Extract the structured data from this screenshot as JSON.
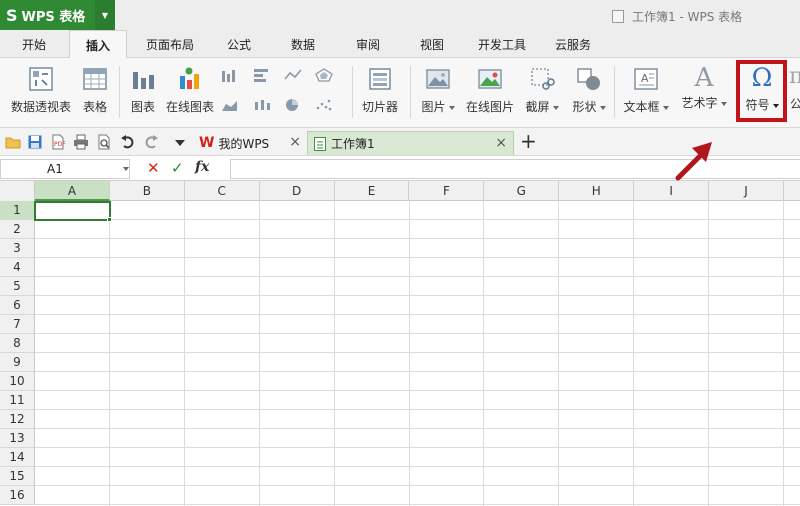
{
  "app": {
    "button_label": "WPS 表格",
    "logo_glyph": "S",
    "window_title": "工作簿1 - WPS 表格"
  },
  "menu": {
    "tabs": [
      {
        "label": "开始",
        "active": false
      },
      {
        "label": "插入",
        "active": true
      },
      {
        "label": "页面布局",
        "active": false
      },
      {
        "label": "公式",
        "active": false
      },
      {
        "label": "数据",
        "active": false
      },
      {
        "label": "审阅",
        "active": false
      },
      {
        "label": "视图",
        "active": false
      },
      {
        "label": "开发工具",
        "active": false
      },
      {
        "label": "云服务",
        "active": false
      }
    ]
  },
  "ribbon": {
    "pivot_table": "数据透视表",
    "table": "表格",
    "chart": "图表",
    "online_chart": "在线图表",
    "slicer": "切片器",
    "picture": "图片",
    "online_picture": "在线图片",
    "screenshot": "截屏",
    "shapes": "形状",
    "textbox": "文本框",
    "wordart": "艺术字",
    "symbol": "符号",
    "symbol_glyph": "Ω",
    "wordart_glyph": "A",
    "formula_cut": "公"
  },
  "doc_tabs": {
    "tabs": [
      {
        "label": "我的WPS",
        "active": false
      },
      {
        "label": "工作簿1",
        "active": true
      }
    ],
    "close_glyph": "×",
    "add_glyph": "+"
  },
  "formula_bar": {
    "cell_ref": "A1",
    "cancel_glyph": "✕",
    "confirm_glyph": "✓",
    "fx_label": "fx",
    "value": ""
  },
  "grid": {
    "columns": [
      "A",
      "B",
      "C",
      "D",
      "E",
      "F",
      "G",
      "H",
      "I",
      "J"
    ],
    "rows": [
      "1",
      "2",
      "3",
      "4",
      "5",
      "6",
      "7",
      "8",
      "9",
      "10",
      "11",
      "12",
      "13",
      "14",
      "15",
      "16"
    ],
    "selected_cell": "A1"
  },
  "colors": {
    "app_green": "#2f8a33",
    "highlight_red": "#c0131a",
    "selection_green": "#2e7d32",
    "omega_blue": "#2f6fc0"
  }
}
